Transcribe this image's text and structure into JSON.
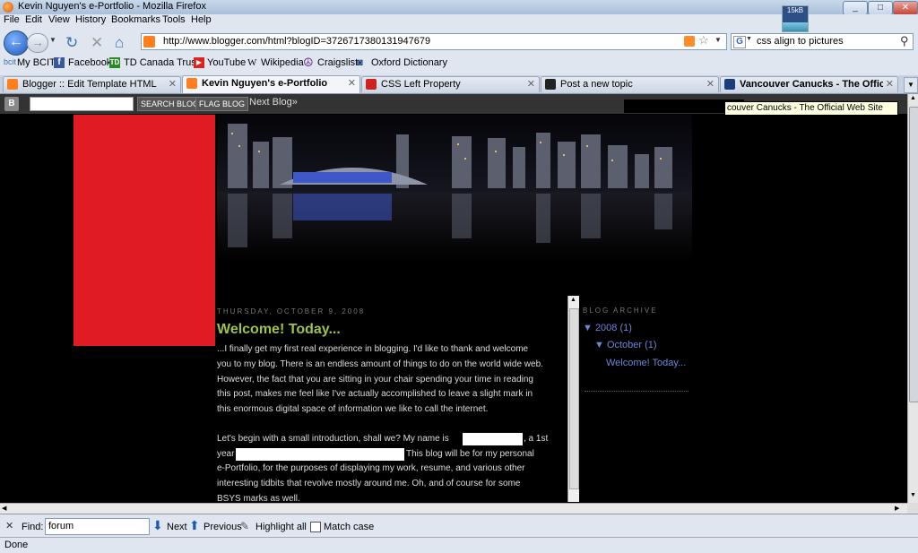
{
  "window": {
    "title": "Kevin Nguyen's e-Portfolio - Mozilla Firefox",
    "min": "_",
    "max": "□",
    "close": "✕"
  },
  "net_meter": {
    "label": "15kB"
  },
  "menu": [
    "File",
    "Edit",
    "View",
    "History",
    "Bookmarks",
    "Tools",
    "Help"
  ],
  "nav": {
    "url": "http://www.blogger.com/html?blogID=3726717380131947679",
    "search_query": "css align to pictures"
  },
  "bookmarks": [
    "My BCIT",
    "Facebook",
    "TD Canada Trust",
    "YouTube",
    "Wikipedia",
    "Craigslist",
    "Oxford Dictionary"
  ],
  "bookmark_icons": [
    "bcit",
    "f",
    "TD",
    "▶",
    "W",
    "☮",
    "◙"
  ],
  "tabs": [
    {
      "label": "Blogger :: Edit Template HTML",
      "active": false
    },
    {
      "label": "Kevin Nguyen's e-Portfolio",
      "active": true
    },
    {
      "label": "CSS Left Property",
      "active": false
    },
    {
      "label": "Post a new topic",
      "active": false
    },
    {
      "label": "Vancouver Canucks - The Official ...",
      "active": false
    }
  ],
  "blogger_bar": {
    "logo": "B",
    "search_btn": "SEARCH BLOG",
    "flag_btn": "FLAG BLOG",
    "next": "Next Blog»",
    "tooltip": "couver Canucks - The Official Web Site"
  },
  "post": {
    "date": "THURSDAY, OCTOBER 9, 2008",
    "title": "Welcome! Today...",
    "lines": [
      "...I finally get my first real experience in blogging. I'd like to thank and welcome",
      "you to my blog. There is an endless amount of things to do on the world wide web.",
      "However, the fact that you are sitting in your chair spending your time in reading",
      "this post, makes me feel like I've actually accomplished to leave a slight mark in",
      "this enormous digital space of information we like to call the internet."
    ],
    "p2_intro": "Let's begin with a small introduction, shall we? My name is",
    "p2_a": ", a 1st",
    "p2_b": "year",
    "p2_c": "This blog will be for my personal",
    "p2_lines": [
      "e-Portfolio, for the purposes of displaying my work, resume, and various other",
      "interesting tidbits that revolve mostly around me. Oh, and of course for some",
      "BSYS marks as well."
    ]
  },
  "archive": {
    "heading": "BLOG ARCHIVE",
    "year": "▼ 2008 (1)",
    "month": "▼ October (1)",
    "post": "Welcome! Today..."
  },
  "findbar": {
    "close": "✕",
    "label": "Find:",
    "query": "forum",
    "next": "Next",
    "previous": "Previous",
    "highlight": "Highlight all",
    "match_case": "Match case"
  },
  "status": "Done",
  "colors": {
    "title_green": "#9fc24a",
    "link_blue": "#6f86d6",
    "redbox": "#e01b24"
  }
}
